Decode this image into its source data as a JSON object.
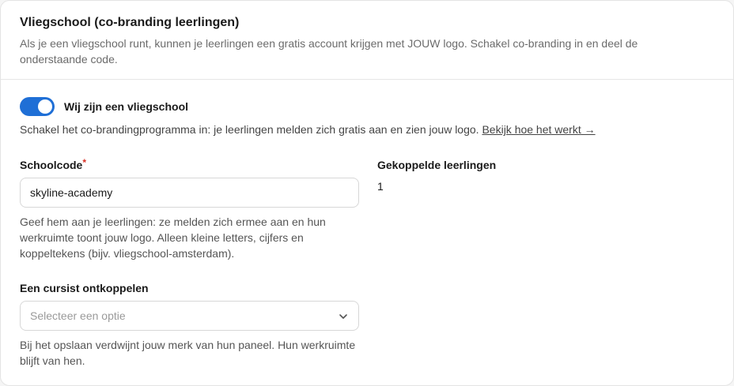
{
  "header": {
    "title": "Vliegschool (co-branding leerlingen)",
    "subtitle": "Als je een vliegschool runt, kunnen je leerlingen een gratis account krijgen met JOUW logo. Schakel co-branding in en deel de onderstaande code."
  },
  "toggle": {
    "label": "Wij zijn een vliegschool",
    "on": true,
    "help": "Schakel het co-brandingprogramma in: je leerlingen melden zich gratis aan en zien jouw logo. ",
    "link": "Bekijk hoe het werkt →",
    "accent": "#1f6fd6"
  },
  "school_code": {
    "label": "Schoolcode",
    "required_mark": "*",
    "value": "skyline-academy",
    "help": "Geef hem aan je leerlingen: ze melden zich ermee aan en hun werkruimte toont jouw logo. Alleen kleine letters, cijfers en koppeltekens (bijv. vliegschool-amsterdam)."
  },
  "linked_students": {
    "label": "Gekoppelde leerlingen",
    "count": "1"
  },
  "unlink": {
    "label": "Een cursist ontkoppelen",
    "placeholder": "Selecteer een optie",
    "help": "Bij het opslaan verdwijnt jouw merk van hun paneel. Hun werkruimte blijft van hen.",
    "icon": "chevron-down-icon"
  }
}
